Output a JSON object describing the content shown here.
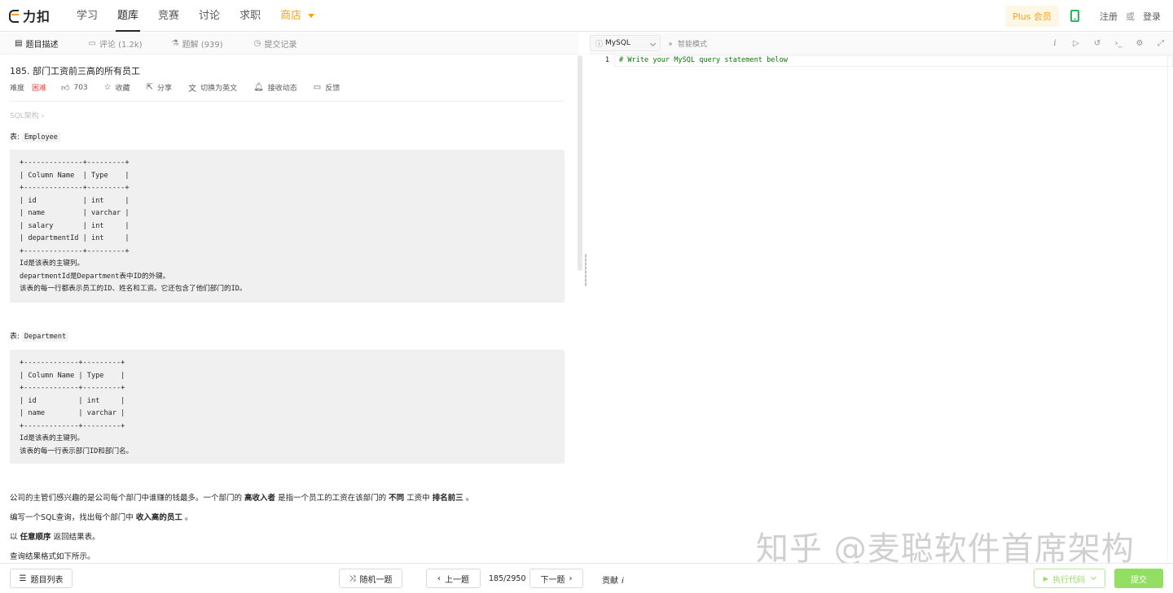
{
  "nav": {
    "logo_text": "力扣",
    "links": [
      "学习",
      "题库",
      "竞赛",
      "讨论",
      "求职",
      "商店"
    ],
    "plus": "Plus 会员",
    "register": "注册",
    "or": "或",
    "login": "登录"
  },
  "left_tabs": [
    {
      "label": "题目描述",
      "icon": "description-icon"
    },
    {
      "label": "评论 (1.2k)",
      "icon": "comment-icon"
    },
    {
      "label": "题解 (939)",
      "icon": "solution-icon"
    },
    {
      "label": "提交记录",
      "icon": "history-icon"
    }
  ],
  "problem": {
    "title": "185. 部门工资前三高的所有员工",
    "difficulty_label": "难度",
    "difficulty": "困难",
    "likes": "703",
    "actions": [
      "收藏",
      "分享",
      "切换为英文",
      "接收动态",
      "反馈"
    ],
    "tag": "SQL架构 ›",
    "table1_prefix": "表: ",
    "table1_name": "Employee",
    "table1_schema": "+--------------+---------+\n| Column Name  | Type    |\n+--------------+---------+\n| id           | int     |\n| name         | varchar |\n| salary       | int     |\n| departmentId | int     |\n+--------------+---------+\nId是该表的主键列。\ndepartmentId是Department表中ID的外键。\n该表的每一行都表示员工的ID、姓名和工资。它还包含了他们部门的ID。",
    "table2_prefix": "表: ",
    "table2_name": "Department",
    "table2_schema": "+-------------+---------+\n| Column Name | Type    |\n+-------------+---------+\n| id          | int     |\n| name        | varchar |\n+-------------+---------+\nId是该表的主键列。\n该表的每一行表示部门ID和部门名。",
    "p1_a": "公司的主管们感兴趣的是公司每个部门中谁赚的钱最多。一个部门的 ",
    "p1_b": "高收入者",
    "p1_c": " 是指一个员工的工资在该部门的 ",
    "p1_d": "不同",
    "p1_e": " 工资中 ",
    "p1_f": "排名前三",
    "p1_g": " 。",
    "p2_a": "编写一个SQL查询，找出每个部门中 ",
    "p2_b": "收入高的员工",
    "p2_c": " 。",
    "p3_a": "以 ",
    "p3_b": "任意顺序",
    "p3_c": " 返回结果表。",
    "p4": "查询结果格式如下所示。"
  },
  "editor": {
    "language": "MySQL",
    "smart_mode": "智能模式",
    "line_number": "1",
    "code": "# Write your MySQL query statement below"
  },
  "watermark": "知乎 @麦聪软件首席架构",
  "bottom": {
    "list": "题目列表",
    "random": "随机一题",
    "prev": "上一题",
    "page": "185/2950",
    "next": "下一题",
    "contrib": "贡献",
    "run": "执行代码",
    "submit": "提交"
  }
}
